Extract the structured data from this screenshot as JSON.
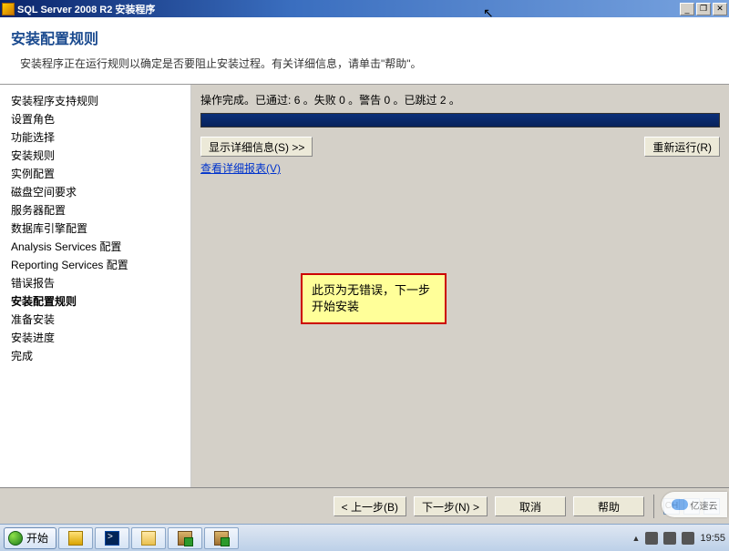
{
  "window": {
    "title": "SQL Server 2008 R2 安装程序"
  },
  "header": {
    "title": "安装配置规则",
    "subtitle": "安装程序正在运行规则以确定是否要阻止安装过程。有关详细信息，请单击\"帮助\"。"
  },
  "sidebar": {
    "items": [
      {
        "label": "安装程序支持规则",
        "bold": false
      },
      {
        "label": "设置角色",
        "bold": false
      },
      {
        "label": "功能选择",
        "bold": false
      },
      {
        "label": "安装规则",
        "bold": false
      },
      {
        "label": "实例配置",
        "bold": false
      },
      {
        "label": "磁盘空间要求",
        "bold": false
      },
      {
        "label": "服务器配置",
        "bold": false
      },
      {
        "label": "数据库引擎配置",
        "bold": false
      },
      {
        "label": "Analysis Services 配置",
        "bold": false
      },
      {
        "label": "Reporting Services 配置",
        "bold": false
      },
      {
        "label": "错误报告",
        "bold": false
      },
      {
        "label": "安装配置规则",
        "bold": true
      },
      {
        "label": "准备安装",
        "bold": false
      },
      {
        "label": "安装进度",
        "bold": false
      },
      {
        "label": "完成",
        "bold": false
      }
    ]
  },
  "content": {
    "status_prefix": "操作完成。已通过:",
    "passed": "6",
    "status_mid1": "。失败",
    "failed": "0",
    "status_mid2": "。警告",
    "warning": "0",
    "status_mid3": "。已跳过",
    "skipped": "2",
    "status_suffix": "。",
    "show_details_btn": "显示详细信息(S) >>",
    "rerun_btn": "重新运行(R)",
    "report_link": "查看详细报表(V)"
  },
  "note": {
    "text": "此页为无错误，下一步开始安装"
  },
  "footer": {
    "back": "< 上一步(B)",
    "next": "下一步(N) >",
    "cancel": "取消",
    "help": "帮助"
  },
  "ime": {
    "lang": "CH"
  },
  "taskbar": {
    "start": "开始",
    "clock": "19:55"
  },
  "watermark": {
    "text": "亿速云"
  }
}
